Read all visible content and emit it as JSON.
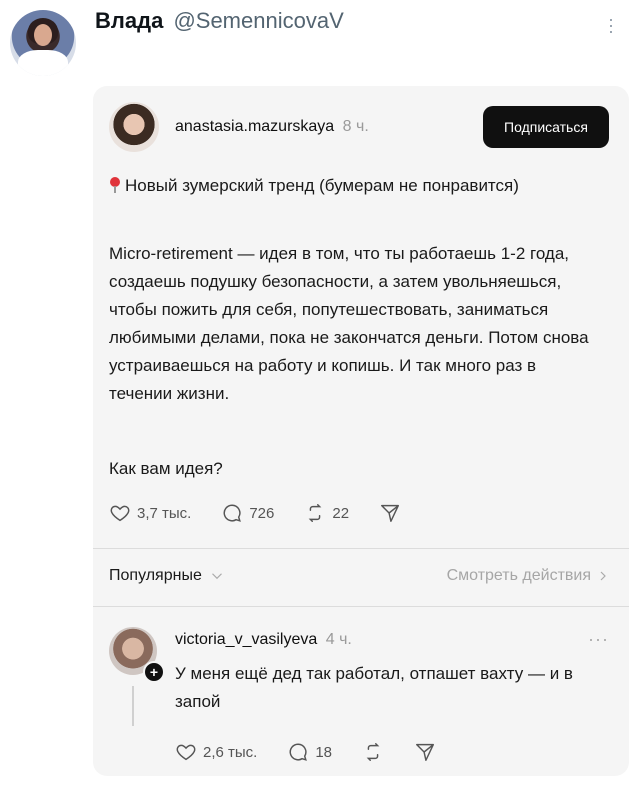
{
  "tweet": {
    "author_name": "Влада",
    "author_handle": "@SemennicovaV"
  },
  "card": {
    "post": {
      "username": "anastasia.mazurskaya",
      "time": "8 ч.",
      "follow_label": "Подписаться",
      "heading": "Новый зумерский тренд (бумерам не понравится)",
      "body": "Micro-retirement — идея в том, что ты работаешь 1-2 года, создаешь подушку безопасности, а затем увольняешься, чтобы пожить для себя, попутешествовать, заниматься любимыми делами, пока не закончатся деньги. Потом снова устраиваешься на работу и копишь. И так много раз в течении жизни.",
      "question": "Как вам идея?",
      "likes": "3,7 тыс.",
      "comments": "726",
      "reposts": "22"
    },
    "sort": {
      "label": "Популярные",
      "see_actions": "Смотреть действия"
    },
    "reply": {
      "username": "victoria_v_vasilyeva",
      "time": "4 ч.",
      "text": "У меня ещё дед так работал, отпашет вахту — и в запой",
      "likes": "2,6 тыс.",
      "comments": "18"
    }
  }
}
